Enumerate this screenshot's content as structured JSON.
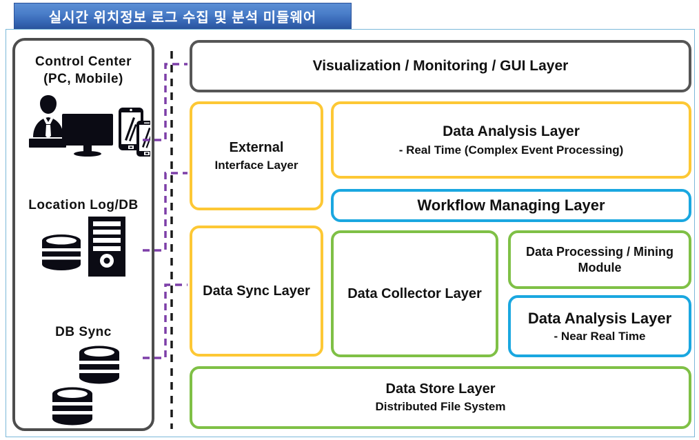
{
  "title": {
    "text": "실시간 위치정보 로그 수집 및 분석 미들웨어"
  },
  "colors": {
    "title_bar_top": "#5b8ed4",
    "title_bar_bottom": "#2b559f",
    "frame_border": "#7ab8d9",
    "panel_border": "#4d4d4d",
    "gray": "#565656",
    "yellow": "#fdc835",
    "blue": "#1aa7e0",
    "green": "#7fc046",
    "connector_purple": "#7d3fa8",
    "connector_black": "#1a1a1a",
    "text": "#111111"
  },
  "left_panel": {
    "groups": [
      {
        "id": "control-center",
        "label_line1": "Control  Center",
        "label_line2": "(PC,  Mobile)",
        "icons": [
          "operator-icon",
          "desktop-monitor-icon",
          "tablet-icon",
          "smartphone-icon"
        ]
      },
      {
        "id": "location-log-db",
        "label_line1": "Location  Log/DB",
        "label_line2": "",
        "icons": [
          "server-tower-icon",
          "database-cylinder-icon"
        ]
      },
      {
        "id": "db-sync",
        "label_line1": "DB  Sync",
        "label_line2": "",
        "icons": [
          "database-cylinder-icon",
          "database-cylinder-icon"
        ]
      }
    ]
  },
  "layers": [
    {
      "id": "visualization-layer",
      "line1": "Visualization / Monitoring / GUI Layer",
      "line2": "",
      "color": "gray",
      "font1": 21,
      "font2": 0
    },
    {
      "id": "external-interface-layer",
      "line1": "External",
      "line2": "Interface Layer",
      "color": "yellow",
      "font1": 19,
      "font2": 17
    },
    {
      "id": "data-analysis-layer-realtime",
      "line1": "Data Analysis Layer",
      "line2": "- Real Time (Complex Event Processing)",
      "color": "yellow",
      "font1": 21,
      "font2": 17
    },
    {
      "id": "workflow-managing-layer",
      "line1": "Workflow Managing Layer",
      "line2": "",
      "color": "blue",
      "font1": 22,
      "font2": 0
    },
    {
      "id": "data-sync-layer",
      "line1": "Data Sync Layer",
      "line2": "",
      "color": "yellow",
      "font1": 19,
      "font2": 0
    },
    {
      "id": "data-collector-layer",
      "line1": "Data Collector Layer",
      "line2": "",
      "color": "green",
      "font1": 19,
      "font2": 0
    },
    {
      "id": "data-processing-mining-module",
      "line1": "Data Processing / Mining",
      "line2": "Module",
      "color": "green",
      "font1": 18,
      "font2": 18
    },
    {
      "id": "data-analysis-layer-near-realtime",
      "line1": "Data Analysis Layer",
      "line2": "- Near Real Time",
      "color": "blue",
      "font1": 22,
      "font2": 17
    },
    {
      "id": "data-store-layer",
      "line1": "Data Store Layer",
      "line2": "Distributed  File System",
      "color": "green",
      "font1": 19,
      "font2": 17
    }
  ],
  "connectors": {
    "vertical_black_dashed": "main-bus-line",
    "purple_links": [
      "control-center-to-visualization-layer",
      "location-log-db-to-external-interface-layer",
      "db-sync-to-data-sync-layer"
    ]
  }
}
